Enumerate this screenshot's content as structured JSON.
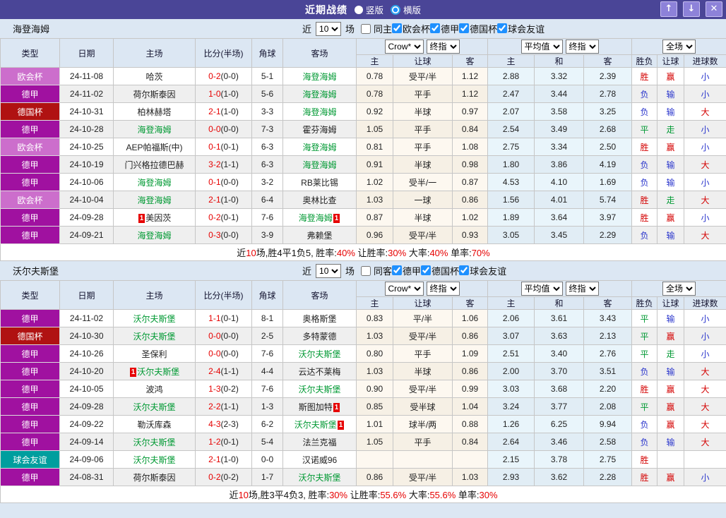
{
  "titlebar": {
    "title": "近期战绩",
    "radio_vertical": "竖版",
    "radio_horizontal": "横版",
    "buttons": {
      "up": "↑",
      "down": "↓",
      "close": "✕"
    }
  },
  "colors": {
    "league": {
      "欧会杯": "#cc6ecc",
      "德甲": "#a011a0",
      "德国杯": "#b01212",
      "球会友谊": "#009e9e"
    },
    "result": {
      "胜": "#d40000",
      "平": "#009933",
      "负": "#2a35cc",
      "赢": "#d40000",
      "走": "#009933",
      "输": "#2a35cc",
      "大": "#d40000",
      "小": "#2a35cc"
    },
    "team_green": "#009933",
    "score_red": "#e60000",
    "titlebar_bg": "#4a4597",
    "checkbox_blue": "#1e90ff"
  },
  "table_header": {
    "type": "类型",
    "date": "日期",
    "home": "主场",
    "score": "比分(半场)",
    "corner": "角球",
    "away": "客场",
    "bookmaker_select": "Crow*",
    "final_select": "终指",
    "avg_select": "平均值",
    "avg_final_select": "终指",
    "fulltime_select": "全场",
    "sub": [
      "主",
      "让球",
      "客",
      "主",
      "和",
      "客",
      "胜负",
      "让球",
      "进球数"
    ]
  },
  "sections": [
    {
      "team": "海登海姆",
      "filter": {
        "prefix": "近",
        "count": "10",
        "suffix": "场",
        "same": "同主",
        "same_checked": false,
        "leagues": [
          "欧会杯",
          "德甲",
          "德国杯",
          "球会友谊"
        ]
      },
      "rows": [
        {
          "league": "欧会杯",
          "date": "24-11-08",
          "home": "哈茨",
          "home_team": false,
          "home_card": false,
          "score": "0-2",
          "half": "(0-0)",
          "corner": "5-1",
          "away": "海登海姆",
          "away_team": true,
          "away_card": false,
          "odds": [
            "0.78",
            "受平/半",
            "1.12"
          ],
          "avg": [
            "2.88",
            "3.32",
            "2.39"
          ],
          "res": [
            "胜",
            "赢",
            "小"
          ]
        },
        {
          "league": "德甲",
          "date": "24-11-02",
          "home": "荷尔斯泰因",
          "home_team": false,
          "home_card": false,
          "score": "1-0",
          "half": "(1-0)",
          "corner": "5-6",
          "away": "海登海姆",
          "away_team": true,
          "away_card": false,
          "odds": [
            "0.78",
            "平手",
            "1.12"
          ],
          "avg": [
            "2.47",
            "3.44",
            "2.78"
          ],
          "res": [
            "负",
            "输",
            "小"
          ]
        },
        {
          "league": "德国杯",
          "date": "24-10-31",
          "home": "柏林赫塔",
          "home_team": false,
          "home_card": false,
          "score": "2-1",
          "half": "(1-0)",
          "corner": "3-3",
          "away": "海登海姆",
          "away_team": true,
          "away_card": false,
          "odds": [
            "0.92",
            "半球",
            "0.97"
          ],
          "avg": [
            "2.07",
            "3.58",
            "3.25"
          ],
          "res": [
            "负",
            "输",
            "大"
          ]
        },
        {
          "league": "德甲",
          "date": "24-10-28",
          "home": "海登海姆",
          "home_team": true,
          "home_card": false,
          "score": "0-0",
          "half": "(0-0)",
          "corner": "7-3",
          "away": "霍芬海姆",
          "away_team": false,
          "away_card": false,
          "odds": [
            "1.05",
            "平手",
            "0.84"
          ],
          "avg": [
            "2.54",
            "3.49",
            "2.68"
          ],
          "res": [
            "平",
            "走",
            "小"
          ]
        },
        {
          "league": "欧会杯",
          "date": "24-10-25",
          "home": "AEP帕福斯(中)",
          "home_team": false,
          "home_card": false,
          "score": "0-1",
          "half": "(0-1)",
          "corner": "6-3",
          "away": "海登海姆",
          "away_team": true,
          "away_card": false,
          "odds": [
            "0.81",
            "平手",
            "1.08"
          ],
          "avg": [
            "2.75",
            "3.34",
            "2.50"
          ],
          "res": [
            "胜",
            "赢",
            "小"
          ]
        },
        {
          "league": "德甲",
          "date": "24-10-19",
          "home": "门兴格拉德巴赫",
          "home_team": false,
          "home_card": false,
          "score": "3-2",
          "half": "(1-1)",
          "corner": "6-3",
          "away": "海登海姆",
          "away_team": true,
          "away_card": false,
          "odds": [
            "0.91",
            "半球",
            "0.98"
          ],
          "avg": [
            "1.80",
            "3.86",
            "4.19"
          ],
          "res": [
            "负",
            "输",
            "大"
          ]
        },
        {
          "league": "德甲",
          "date": "24-10-06",
          "home": "海登海姆",
          "home_team": true,
          "home_card": false,
          "score": "0-1",
          "half": "(0-0)",
          "corner": "3-2",
          "away": "RB莱比锡",
          "away_team": false,
          "away_card": false,
          "odds": [
            "1.02",
            "受半/一",
            "0.87"
          ],
          "avg": [
            "4.53",
            "4.10",
            "1.69"
          ],
          "res": [
            "负",
            "输",
            "小"
          ]
        },
        {
          "league": "欧会杯",
          "date": "24-10-04",
          "home": "海登海姆",
          "home_team": true,
          "home_card": false,
          "score": "2-1",
          "half": "(1-0)",
          "corner": "6-4",
          "away": "奥林比查",
          "away_team": false,
          "away_card": false,
          "odds": [
            "1.03",
            "一球",
            "0.86"
          ],
          "avg": [
            "1.56",
            "4.01",
            "5.74"
          ],
          "res": [
            "胜",
            "走",
            "大"
          ]
        },
        {
          "league": "德甲",
          "date": "24-09-28",
          "home": "美因茨",
          "home_team": false,
          "home_card": "before",
          "score": "0-2",
          "half": "(0-1)",
          "corner": "7-6",
          "away": "海登海姆",
          "away_team": true,
          "away_card": "after",
          "odds": [
            "0.87",
            "半球",
            "1.02"
          ],
          "avg": [
            "1.89",
            "3.64",
            "3.97"
          ],
          "res": [
            "胜",
            "赢",
            "小"
          ]
        },
        {
          "league": "德甲",
          "date": "24-09-21",
          "home": "海登海姆",
          "home_team": true,
          "home_card": false,
          "score": "0-3",
          "half": "(0-0)",
          "corner": "3-9",
          "away": "弗赖堡",
          "away_team": false,
          "away_card": false,
          "odds": [
            "0.96",
            "受平/半",
            "0.93"
          ],
          "avg": [
            "3.05",
            "3.45",
            "2.29"
          ],
          "res": [
            "负",
            "输",
            "大"
          ]
        }
      ],
      "summary": [
        [
          "近",
          0
        ],
        [
          "10",
          1
        ],
        [
          "场,胜4平1负5, 胜率:",
          0
        ],
        [
          "40%",
          1
        ],
        [
          " 让胜率:",
          0
        ],
        [
          "30%",
          1
        ],
        [
          " 大率:",
          0
        ],
        [
          "40%",
          1
        ],
        [
          " 单率:",
          0
        ],
        [
          "70%",
          1
        ]
      ]
    },
    {
      "team": "沃尔夫斯堡",
      "filter": {
        "prefix": "近",
        "count": "10",
        "suffix": "场",
        "same": "同客",
        "same_checked": false,
        "leagues": [
          "德甲",
          "德国杯",
          "球会友谊"
        ]
      },
      "rows": [
        {
          "league": "德甲",
          "date": "24-11-02",
          "home": "沃尔夫斯堡",
          "home_team": true,
          "home_card": false,
          "score": "1-1",
          "half": "(0-1)",
          "corner": "8-1",
          "away": "奥格斯堡",
          "away_team": false,
          "away_card": false,
          "odds": [
            "0.83",
            "平/半",
            "1.06"
          ],
          "avg": [
            "2.06",
            "3.61",
            "3.43"
          ],
          "res": [
            "平",
            "输",
            "小"
          ]
        },
        {
          "league": "德国杯",
          "date": "24-10-30",
          "home": "沃尔夫斯堡",
          "home_team": true,
          "home_card": false,
          "score": "0-0",
          "half": "(0-0)",
          "corner": "2-5",
          "away": "多特蒙德",
          "away_team": false,
          "away_card": false,
          "odds": [
            "1.03",
            "受平/半",
            "0.86"
          ],
          "avg": [
            "3.07",
            "3.63",
            "2.13"
          ],
          "res": [
            "平",
            "赢",
            "小"
          ]
        },
        {
          "league": "德甲",
          "date": "24-10-26",
          "home": "圣保利",
          "home_team": false,
          "home_card": false,
          "score": "0-0",
          "half": "(0-0)",
          "corner": "7-6",
          "away": "沃尔夫斯堡",
          "away_team": true,
          "away_card": false,
          "odds": [
            "0.80",
            "平手",
            "1.09"
          ],
          "avg": [
            "2.51",
            "3.40",
            "2.76"
          ],
          "res": [
            "平",
            "走",
            "小"
          ]
        },
        {
          "league": "德甲",
          "date": "24-10-20",
          "home": "沃尔夫斯堡",
          "home_team": true,
          "home_card": "before",
          "score": "2-4",
          "half": "(1-1)",
          "corner": "4-4",
          "away": "云达不莱梅",
          "away_team": false,
          "away_card": false,
          "odds": [
            "1.03",
            "半球",
            "0.86"
          ],
          "avg": [
            "2.00",
            "3.70",
            "3.51"
          ],
          "res": [
            "负",
            "输",
            "大"
          ]
        },
        {
          "league": "德甲",
          "date": "24-10-05",
          "home": "波鸿",
          "home_team": false,
          "home_card": false,
          "score": "1-3",
          "half": "(0-2)",
          "corner": "7-6",
          "away": "沃尔夫斯堡",
          "away_team": true,
          "away_card": false,
          "odds": [
            "0.90",
            "受平/半",
            "0.99"
          ],
          "avg": [
            "3.03",
            "3.68",
            "2.20"
          ],
          "res": [
            "胜",
            "赢",
            "大"
          ]
        },
        {
          "league": "德甲",
          "date": "24-09-28",
          "home": "沃尔夫斯堡",
          "home_team": true,
          "home_card": false,
          "score": "2-2",
          "half": "(1-1)",
          "corner": "1-3",
          "away": "斯图加特",
          "away_team": false,
          "away_card": "after",
          "odds": [
            "0.85",
            "受半球",
            "1.04"
          ],
          "avg": [
            "3.24",
            "3.77",
            "2.08"
          ],
          "res": [
            "平",
            "赢",
            "大"
          ]
        },
        {
          "league": "德甲",
          "date": "24-09-22",
          "home": "勒沃库森",
          "home_team": false,
          "home_card": false,
          "score": "4-3",
          "half": "(2-3)",
          "corner": "6-2",
          "away": "沃尔夫斯堡",
          "away_team": true,
          "away_card": "after",
          "odds": [
            "1.01",
            "球半/两",
            "0.88"
          ],
          "avg": [
            "1.26",
            "6.25",
            "9.94"
          ],
          "res": [
            "负",
            "赢",
            "大"
          ]
        },
        {
          "league": "德甲",
          "date": "24-09-14",
          "home": "沃尔夫斯堡",
          "home_team": true,
          "home_card": false,
          "score": "1-2",
          "half": "(0-1)",
          "corner": "5-4",
          "away": "法兰克福",
          "away_team": false,
          "away_card": false,
          "odds": [
            "1.05",
            "平手",
            "0.84"
          ],
          "avg": [
            "2.64",
            "3.46",
            "2.58"
          ],
          "res": [
            "负",
            "输",
            "大"
          ]
        },
        {
          "league": "球会友谊",
          "date": "24-09-06",
          "home": "沃尔夫斯堡",
          "home_team": true,
          "home_card": false,
          "score": "2-1",
          "half": "(1-0)",
          "corner": "0-0",
          "away": "汉诺威96",
          "away_team": false,
          "away_card": false,
          "odds": [
            "",
            "",
            ""
          ],
          "avg": [
            "2.15",
            "3.78",
            "2.75"
          ],
          "res": [
            "胜",
            "",
            ""
          ]
        },
        {
          "league": "德甲",
          "date": "24-08-31",
          "home": "荷尔斯泰因",
          "home_team": false,
          "home_card": false,
          "score": "0-2",
          "half": "(0-2)",
          "corner": "1-7",
          "away": "沃尔夫斯堡",
          "away_team": true,
          "away_card": false,
          "odds": [
            "0.86",
            "受平/半",
            "1.03"
          ],
          "avg": [
            "2.93",
            "3.62",
            "2.28"
          ],
          "res": [
            "胜",
            "赢",
            "小"
          ]
        }
      ],
      "summary": [
        [
          "近",
          0
        ],
        [
          "10",
          1
        ],
        [
          "场,胜3平4负3, 胜率:",
          0
        ],
        [
          "30%",
          1
        ],
        [
          " 让胜率:",
          0
        ],
        [
          "55.6%",
          1
        ],
        [
          " 大率:",
          0
        ],
        [
          "55.6%",
          1
        ],
        [
          " 单率:",
          0
        ],
        [
          "30%",
          1
        ]
      ]
    }
  ]
}
